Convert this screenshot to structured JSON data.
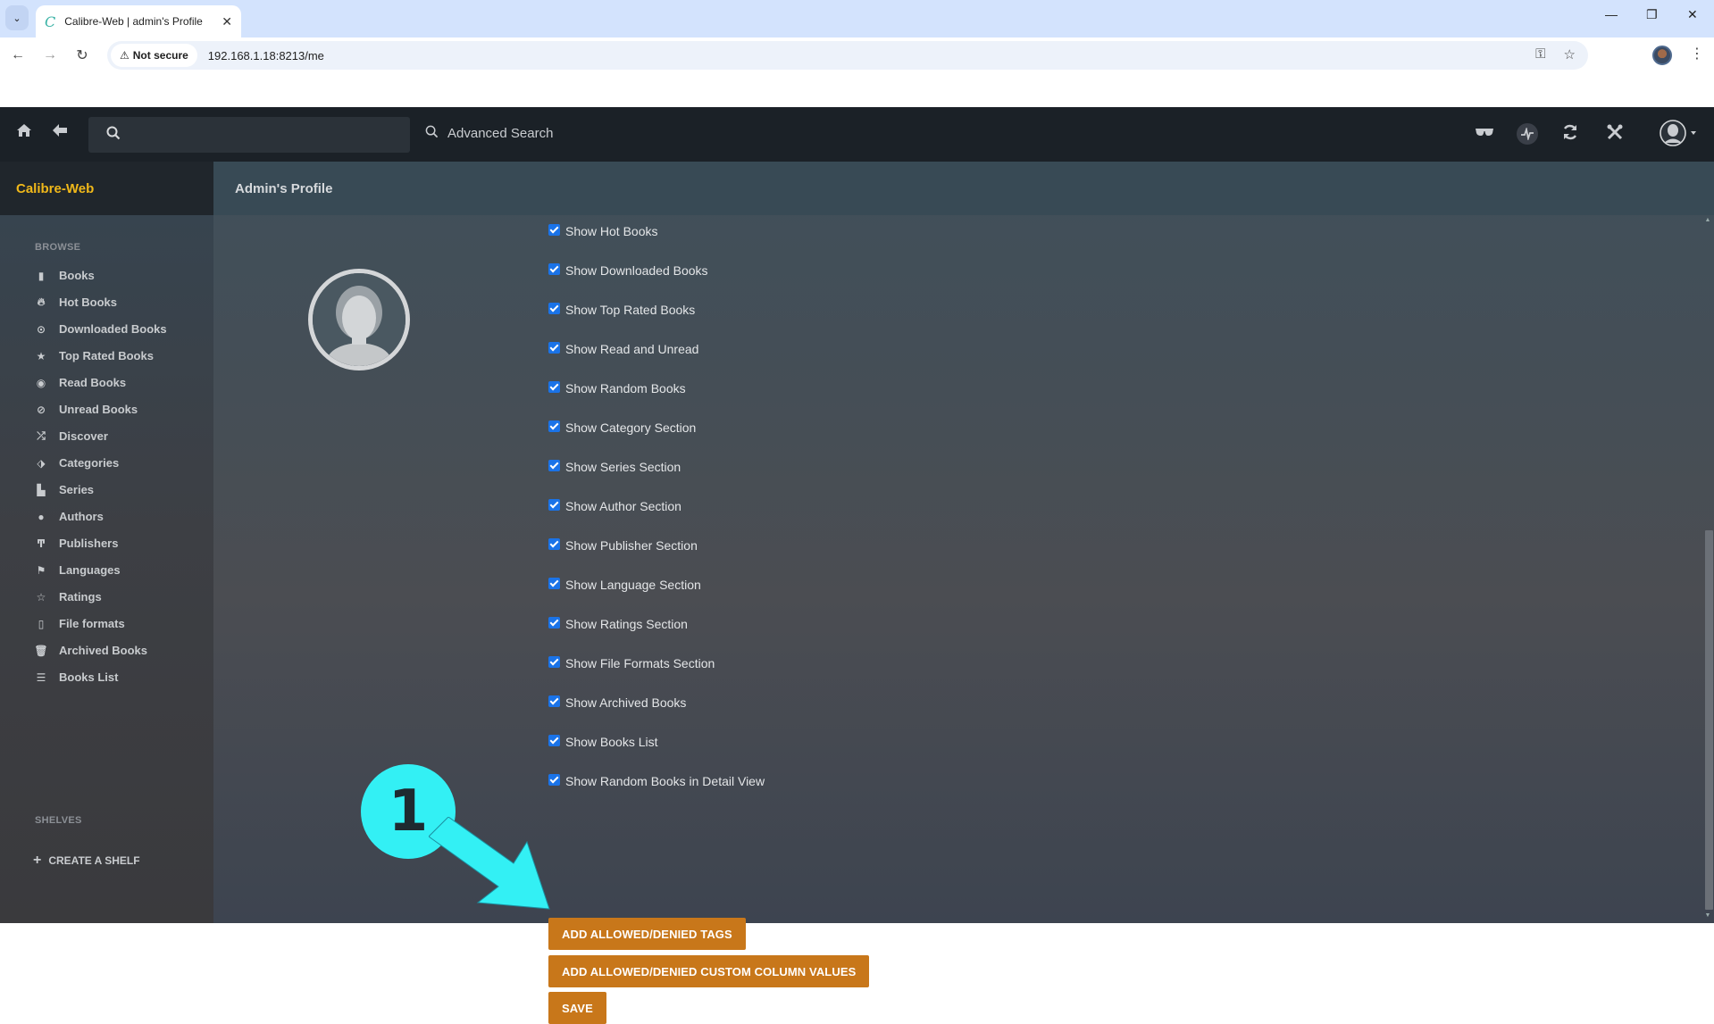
{
  "browser": {
    "tab_title": "Calibre-Web | admin's Profile",
    "tab_close": "✕",
    "security_label": "Not secure",
    "url": "192.168.1.18:8213/me",
    "window_controls": {
      "minimize": "—",
      "maximize": "❐",
      "close": "✕"
    }
  },
  "navbar": {
    "search_placeholder": "",
    "advanced_search_label": "Advanced Search",
    "icons": [
      "home-icon",
      "back-icon",
      "search-icon",
      "glasses-icon",
      "activity-icon",
      "refresh-icon",
      "tools-icon",
      "user-menu-icon"
    ]
  },
  "brand": "Calibre-Web",
  "page_title": "Admin's Profile",
  "sidebar": {
    "browse_heading": "BROWSE",
    "items": [
      {
        "label": "Books",
        "icon": "book-icon"
      },
      {
        "label": "Hot Books",
        "icon": "fire-icon"
      },
      {
        "label": "Downloaded Books",
        "icon": "download-icon"
      },
      {
        "label": "Top Rated Books",
        "icon": "star-icon"
      },
      {
        "label": "Read Books",
        "icon": "eye-icon"
      },
      {
        "label": "Unread Books",
        "icon": "eye-slash-icon"
      },
      {
        "label": "Discover",
        "icon": "shuffle-icon"
      },
      {
        "label": "Categories",
        "icon": "tags-icon"
      },
      {
        "label": "Series",
        "icon": "bookmark-icon"
      },
      {
        "label": "Authors",
        "icon": "user-icon"
      },
      {
        "label": "Publishers",
        "icon": "text-size-icon"
      },
      {
        "label": "Languages",
        "icon": "flag-icon"
      },
      {
        "label": "Ratings",
        "icon": "star-outline-icon"
      },
      {
        "label": "File formats",
        "icon": "file-icon"
      },
      {
        "label": "Archived Books",
        "icon": "trash-icon"
      },
      {
        "label": "Books List",
        "icon": "list-icon"
      }
    ],
    "shelves_heading": "SHELVES",
    "create_shelf_label": "CREATE A SHELF"
  },
  "settings": {
    "checkboxes": [
      {
        "label": "Show Hot Books",
        "checked": true
      },
      {
        "label": "Show Downloaded Books",
        "checked": true
      },
      {
        "label": "Show Top Rated Books",
        "checked": true
      },
      {
        "label": "Show Read and Unread",
        "checked": true
      },
      {
        "label": "Show Random Books",
        "checked": true
      },
      {
        "label": "Show Category Section",
        "checked": true
      },
      {
        "label": "Show Series Section",
        "checked": true
      },
      {
        "label": "Show Author Section",
        "checked": true
      },
      {
        "label": "Show Publisher Section",
        "checked": true
      },
      {
        "label": "Show Language Section",
        "checked": true
      },
      {
        "label": "Show Ratings Section",
        "checked": true
      },
      {
        "label": "Show File Formats Section",
        "checked": true
      },
      {
        "label": "Show Archived Books",
        "checked": true
      },
      {
        "label": "Show Books List",
        "checked": true
      },
      {
        "label": "Show Random Books in Detail View",
        "checked": true
      }
    ],
    "buttons": {
      "allowed_tags": "ADD ALLOWED/DENIED TAGS",
      "allowed_custom_columns": "ADD ALLOWED/DENIED CUSTOM COLUMN VALUES",
      "save": "SAVE"
    }
  },
  "annotation": {
    "step_number": "1",
    "color": "#33f0f4"
  },
  "colors": {
    "brand": "#f0b81a",
    "button": "#c8771a",
    "checkbox": "#1a73e8"
  }
}
